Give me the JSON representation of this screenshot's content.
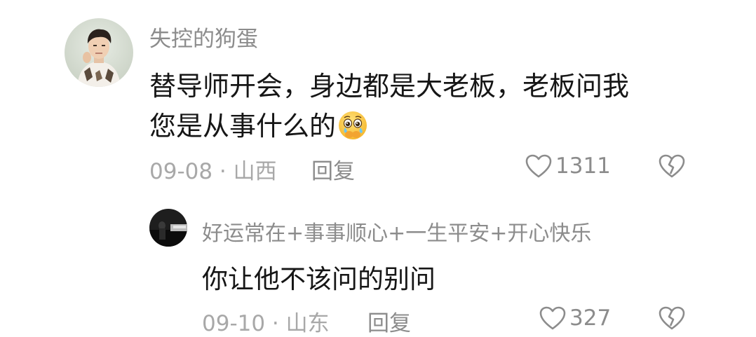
{
  "comments": [
    {
      "username": "失控的狗蛋",
      "text_lines": [
        "替导师开会，身边都是大老板，老板问我",
        "您是从事什么的"
      ],
      "emoji": "holding-back-tears-emoji",
      "date": "09-08",
      "separator": "·",
      "location": "山西",
      "meta": "09-08 · 山西",
      "reply_label": "回复",
      "like_count": "1311",
      "like_icon": "heart-outline-icon",
      "dislike_icon": "broken-heart-icon"
    },
    {
      "username": "好运常在+事事顺心+一生平安+开心快乐",
      "text_lines": [
        "你让他不该问的别问"
      ],
      "date": "09-10",
      "separator": "·",
      "location": "山东",
      "meta": "09-10 · 山东",
      "reply_label": "回复",
      "like_count": "327",
      "like_icon": "heart-outline-icon",
      "dislike_icon": "broken-heart-icon"
    }
  ],
  "colors": {
    "username": "#8c8c8c",
    "text": "#161616",
    "meta": "#a8a8a8",
    "icon": "#8c8c8c",
    "background": "#ffffff"
  }
}
